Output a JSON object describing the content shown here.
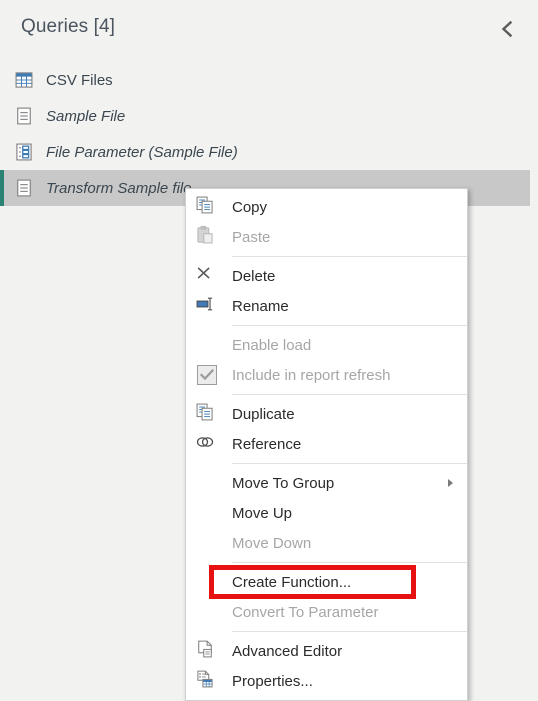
{
  "pane": {
    "title": "Queries [4]",
    "collapse_icon": "chevron-left-icon",
    "accent_color": "#2a8274",
    "selected_row_bg": "#c8c8c8",
    "background": "#f2f2f0"
  },
  "queries": [
    {
      "label": "CSV Files",
      "icon": "table-icon",
      "italic": false,
      "selected": false
    },
    {
      "label": "Sample File",
      "icon": "list-icon",
      "italic": true,
      "selected": false
    },
    {
      "label": "File Parameter (Sample File)",
      "icon": "parameter-icon",
      "italic": true,
      "selected": false
    },
    {
      "label": "Transform Sample file",
      "icon": "list-icon",
      "italic": true,
      "selected": true
    }
  ],
  "context_menu": {
    "highlight_color": "#e81111",
    "items": [
      {
        "label": "Copy",
        "icon": "copy-icon",
        "disabled": false,
        "type": "item"
      },
      {
        "label": "Paste",
        "icon": "paste-icon",
        "disabled": true,
        "type": "item"
      },
      {
        "type": "separator"
      },
      {
        "label": "Delete",
        "icon": "delete-x-icon",
        "disabled": false,
        "type": "item"
      },
      {
        "label": "Rename",
        "icon": "rename-icon",
        "disabled": false,
        "type": "item"
      },
      {
        "type": "separator"
      },
      {
        "label": "Enable load",
        "icon": "none",
        "disabled": true,
        "type": "item"
      },
      {
        "label": "Include in report refresh",
        "icon": "checkbox-checked-icon",
        "disabled": true,
        "type": "checkbox",
        "checked": true
      },
      {
        "type": "separator"
      },
      {
        "label": "Duplicate",
        "icon": "duplicate-icon",
        "disabled": false,
        "type": "item"
      },
      {
        "label": "Reference",
        "icon": "reference-link-icon",
        "disabled": false,
        "type": "item"
      },
      {
        "type": "separator"
      },
      {
        "label": "Move To Group",
        "icon": "none",
        "disabled": false,
        "type": "submenu"
      },
      {
        "label": "Move Up",
        "icon": "none",
        "disabled": false,
        "type": "item"
      },
      {
        "label": "Move Down",
        "icon": "none",
        "disabled": true,
        "type": "item"
      },
      {
        "type": "separator"
      },
      {
        "label": "Create Function...",
        "icon": "none",
        "disabled": false,
        "type": "item",
        "highlighted": true
      },
      {
        "label": "Convert To Parameter",
        "icon": "none",
        "disabled": true,
        "type": "item"
      },
      {
        "type": "separator"
      },
      {
        "label": "Advanced Editor",
        "icon": "advanced-editor-icon",
        "disabled": false,
        "type": "item"
      },
      {
        "label": "Properties...",
        "icon": "properties-icon",
        "disabled": false,
        "type": "item"
      }
    ]
  }
}
